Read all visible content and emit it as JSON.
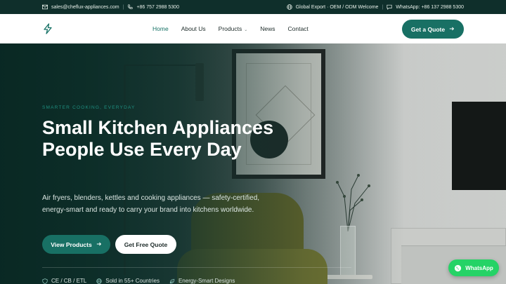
{
  "topbar": {
    "email": "sales@cheflux-appliances.com",
    "phone": "+86 757 2988 5300",
    "export_note": "Global Export · OEM / ODM Welcome",
    "separator": "|",
    "whatsapp": "WhatsApp: +86 137 2988 5300"
  },
  "nav": {
    "items": [
      {
        "label": "Home",
        "active": true
      },
      {
        "label": "About Us",
        "active": false
      },
      {
        "label": "Products",
        "active": false,
        "has_dropdown": true
      },
      {
        "label": "News",
        "active": false
      },
      {
        "label": "Contact",
        "active": false
      }
    ],
    "cta_label": "Get a Quote"
  },
  "hero": {
    "eyebrow": "SMARTER COOKING, EVERYDAY",
    "title": "Small Kitchen Appliances People Use Every Day",
    "lead": "Air fryers, blenders, kettles and cooking appliances — safety-certified, energy-smart and ready to carry your brand into kitchens worldwide.",
    "primary_button": "View Products",
    "secondary_button": "Get Free Quote",
    "badges": [
      {
        "label": "CE / CB / ETL",
        "icon": "shield-icon"
      },
      {
        "label": "Sold in 55+ Countries",
        "icon": "globe-icon"
      },
      {
        "label": "Energy-Smart Designs",
        "icon": "leaf-icon"
      }
    ]
  },
  "floating": {
    "whatsapp_label": "WhatsApp"
  },
  "colors": {
    "brand": "#187064",
    "topbar_bg": "#0f2f2b",
    "whatsapp": "#25d366"
  },
  "icons": [
    "mail-icon",
    "phone-icon",
    "globe-icon",
    "chat-icon",
    "bolt-logo-icon",
    "arrow-right-icon",
    "whatsapp-icon"
  ]
}
